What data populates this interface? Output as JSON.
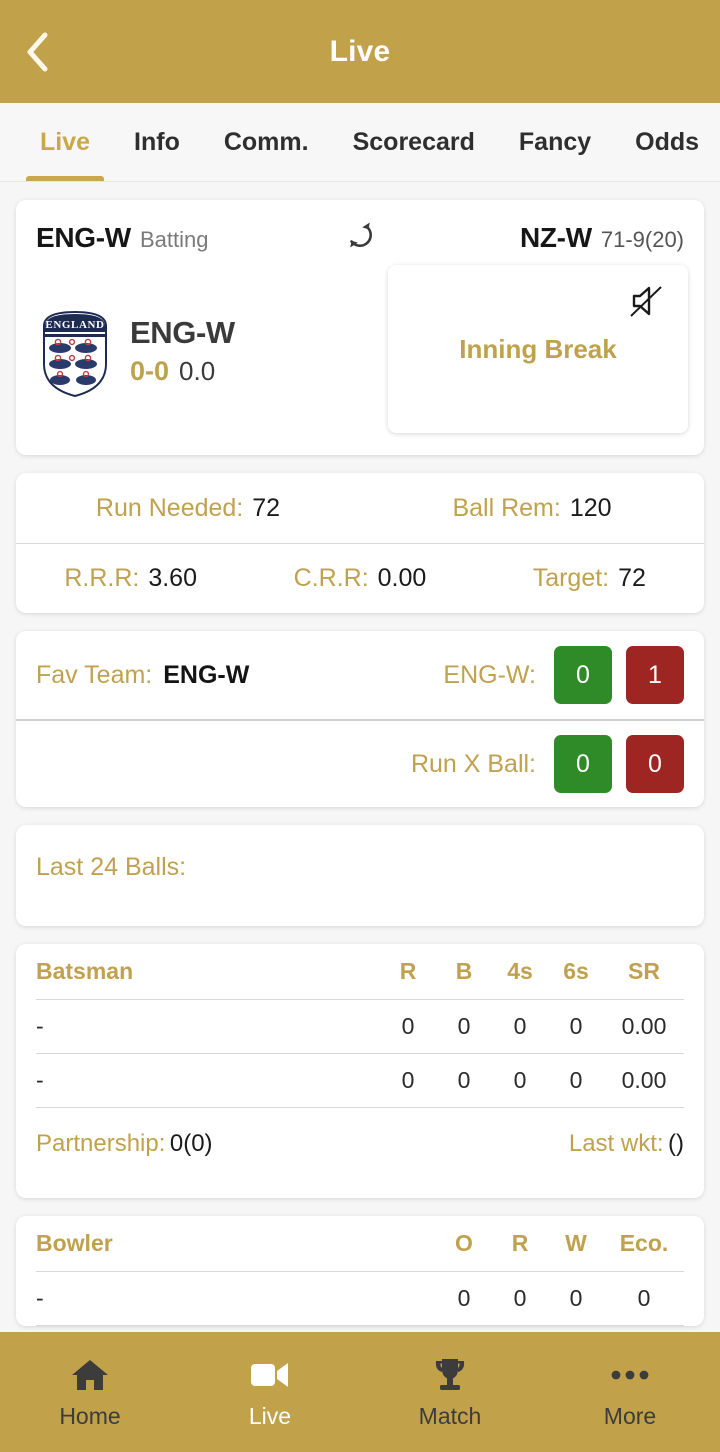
{
  "appbar": {
    "title": "Live",
    "back_icon": "chevron-left-icon"
  },
  "tabs": [
    {
      "label": "Live",
      "active": true
    },
    {
      "label": "Info",
      "active": false
    },
    {
      "label": "Comm.",
      "active": false
    },
    {
      "label": "Scorecard",
      "active": false
    },
    {
      "label": "Fancy",
      "active": false
    },
    {
      "label": "Odds",
      "active": false
    }
  ],
  "match": {
    "left_team": "ENG-W",
    "left_status": "Batting",
    "refresh_icon": "refresh-icon",
    "right_team": "NZ-W",
    "right_score": "71-9(20)",
    "batting": {
      "crest_icon": "england-crest-icon",
      "team_name": "ENG-W",
      "score": "0-0",
      "overs": "0.0"
    },
    "break_box": {
      "text": "Inning Break",
      "mute_icon": "volume-mute-icon"
    }
  },
  "stats": {
    "row1": [
      {
        "label": "Run Needed:",
        "value": "72"
      },
      {
        "label": "Ball Rem:",
        "value": "120"
      }
    ],
    "row2": [
      {
        "label": "R.R.R:",
        "value": "3.60"
      },
      {
        "label": "C.R.R:",
        "value": "0.00"
      },
      {
        "label": "Target:",
        "value": "72"
      }
    ]
  },
  "fav": {
    "row1": {
      "label": "Fav Team:",
      "value": "ENG-W",
      "right_label": "ENG-W:",
      "back": "0",
      "lay": "1"
    },
    "row2": {
      "right_label": "Run X Ball:",
      "back": "0",
      "lay": "0"
    }
  },
  "last_balls": {
    "label": "Last 24 Balls:",
    "balls": []
  },
  "batsman_table": {
    "headers": {
      "name": "Batsman",
      "r": "R",
      "b": "B",
      "fours": "4s",
      "sixes": "6s",
      "sr": "SR"
    },
    "rows": [
      {
        "name": "-",
        "r": "0",
        "b": "0",
        "fours": "0",
        "sixes": "0",
        "sr": "0.00"
      },
      {
        "name": "-",
        "r": "0",
        "b": "0",
        "fours": "0",
        "sixes": "0",
        "sr": "0.00"
      }
    ],
    "partnership_label": "Partnership:",
    "partnership_value": "0(0)",
    "lastwkt_label": "Last wkt:",
    "lastwkt_value": "()"
  },
  "bowler_table": {
    "headers": {
      "name": "Bowler",
      "o": "O",
      "r": "R",
      "w": "W",
      "eco": "Eco."
    },
    "rows": [
      {
        "name": "-",
        "o": "0",
        "r": "0",
        "w": "0",
        "eco": "0"
      }
    ]
  },
  "bottomnav": [
    {
      "label": "Home",
      "icon": "home-icon",
      "active": false
    },
    {
      "label": "Live",
      "icon": "video-camera-icon",
      "active": true
    },
    {
      "label": "Match",
      "icon": "trophy-icon",
      "active": false
    },
    {
      "label": "More",
      "icon": "ellipsis-icon",
      "active": false
    }
  ],
  "colors": {
    "brand_gold": "#c2a14b",
    "accent_gold": "#c0a14e",
    "back_green": "#2e8b28",
    "lay_red": "#9e2622",
    "page_bg": "#f6f6f6"
  }
}
